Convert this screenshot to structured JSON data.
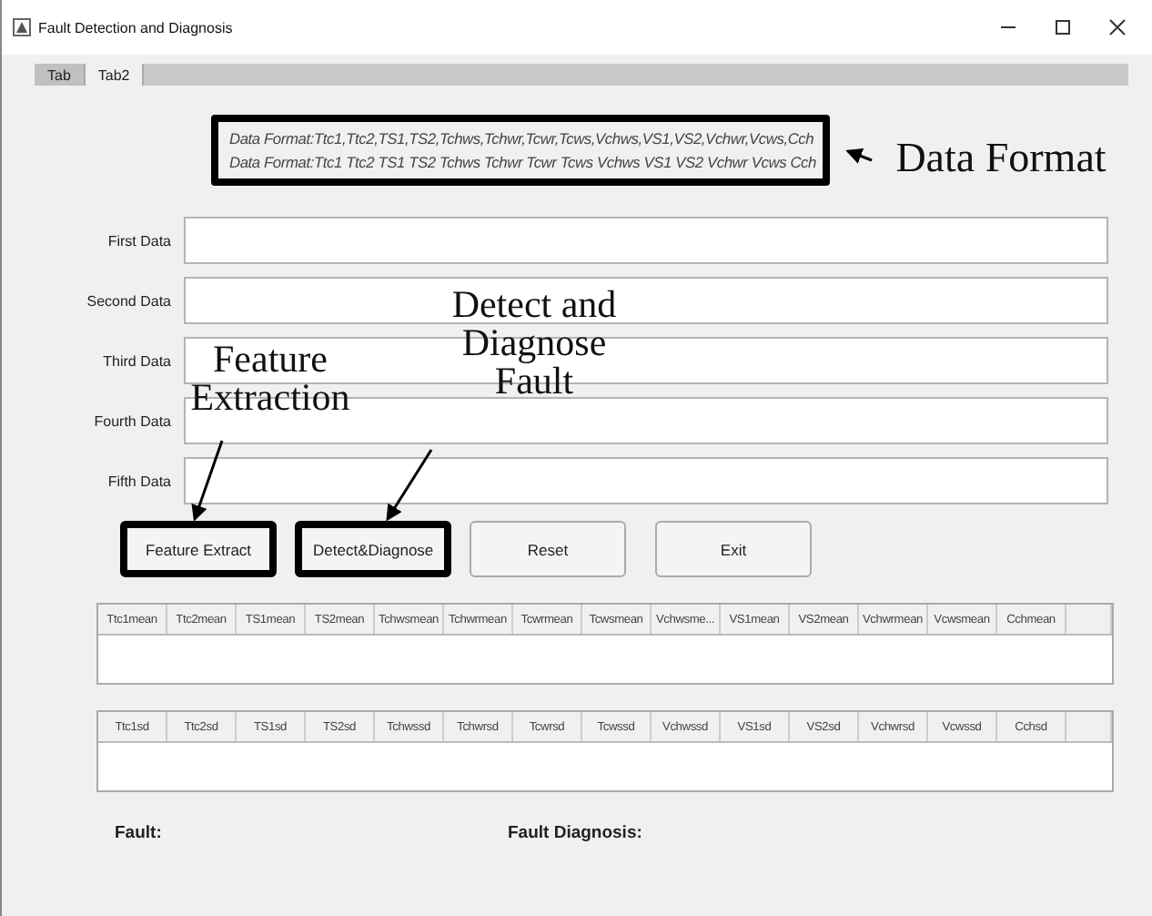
{
  "window": {
    "title": "Fault Detection and Diagnosis"
  },
  "tabs": [
    {
      "label": "Tab",
      "selected": false
    },
    {
      "label": "Tab2",
      "selected": true
    }
  ],
  "data_format": {
    "highlighted": true,
    "lines": [
      "Data Format:Ttc1,Ttc2,TS1,TS2,Tchws,Tchwr,Tcwr,Tcws,Vchws,VS1,VS2,Vchwr,Vcws,Cch",
      "Data Format:Ttc1 Ttc2 TS1 TS2 Tchws Tchwr Tcwr Tcws Vchws VS1 VS2 Vchwr Vcws Cch"
    ]
  },
  "fields": [
    {
      "label": "First Data"
    },
    {
      "label": "Second Data"
    },
    {
      "label": "Third Data"
    },
    {
      "label": "Fourth Data"
    },
    {
      "label": "Fifth Data"
    }
  ],
  "buttons": [
    {
      "label": "Feature Extract",
      "highlighted": true
    },
    {
      "label": "Detect&Diagnose",
      "highlighted": true
    },
    {
      "label": "Reset",
      "highlighted": false
    },
    {
      "label": "Exit",
      "highlighted": false
    }
  ],
  "mean_table": {
    "columns": [
      "Ttc1mean",
      "Ttc2mean",
      "TS1mean",
      "TS2mean",
      "Tchwsmean",
      "Tchwrmean",
      "Tcwrmean",
      "Tcwsmean",
      "Vchwsme...",
      "VS1mean",
      "VS2mean",
      "Vchwrmean",
      "Vcwsmean",
      "Cchmean"
    ]
  },
  "sd_table": {
    "columns": [
      "Ttc1sd",
      "Ttc2sd",
      "TS1sd",
      "TS2sd",
      "Tchwssd",
      "Tchwrsd",
      "Tcwrsd",
      "Tcwssd",
      "Vchwssd",
      "VS1sd",
      "VS2sd",
      "Vchwrsd",
      "Vcwssd",
      "Cchsd"
    ]
  },
  "results": [
    {
      "label": "Fault:"
    },
    {
      "label": "Fault Diagnosis:"
    }
  ],
  "annotations": [
    {
      "text": "Data Format"
    },
    {
      "text": "Feature Extraction"
    },
    {
      "text": "Detect and Diagnose Fault"
    }
  ]
}
